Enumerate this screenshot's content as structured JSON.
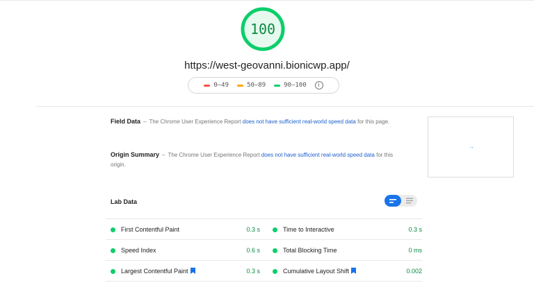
{
  "score": {
    "value": "100",
    "color": "#0cce6b"
  },
  "url": "https://west-geovanni.bionicwp.app/",
  "legend": {
    "items": [
      {
        "range": "0–49",
        "color": "#ff4e42"
      },
      {
        "range": "50–89",
        "color": "#ffa400"
      },
      {
        "range": "90–100",
        "color": "#0cce6b"
      }
    ],
    "info_icon": "i"
  },
  "field_data": {
    "title": "Field Data",
    "dash": "–",
    "text_before": "The Chrome User Experience Report",
    "link": "does not have sufficient real-world speed data",
    "text_after": "for this page."
  },
  "origin_summary": {
    "title": "Origin Summary",
    "dash": "–",
    "text_before": "The Chrome User Experience Report",
    "link": "does not have sufficient real-world speed data",
    "text_after": "for this origin."
  },
  "thumbnail": {
    "arrow": "→"
  },
  "lab_data": {
    "title": "Lab Data",
    "view_toggle": {
      "active": "list-view",
      "inactive": "text-view"
    },
    "metrics": [
      {
        "label": "First Contentful Paint",
        "value": "0.3 s",
        "status": "pass"
      },
      {
        "label": "Time to Interactive",
        "value": "0.3 s",
        "status": "pass"
      },
      {
        "label": "Speed Index",
        "value": "0.6 s",
        "status": "pass"
      },
      {
        "label": "Total Blocking Time",
        "value": "0 ms",
        "status": "pass"
      },
      {
        "label": "Largest Contentful Paint",
        "value": "0.3 s",
        "status": "pass",
        "bookmark": true
      },
      {
        "label": "Cumulative Layout Shift",
        "value": "0.002",
        "status": "pass",
        "bookmark": true
      }
    ]
  },
  "colors": {
    "pass": "#0cce6b",
    "pass_text": "#0a8a44",
    "link": "#1a5fcc",
    "accent": "#1a73e8"
  }
}
